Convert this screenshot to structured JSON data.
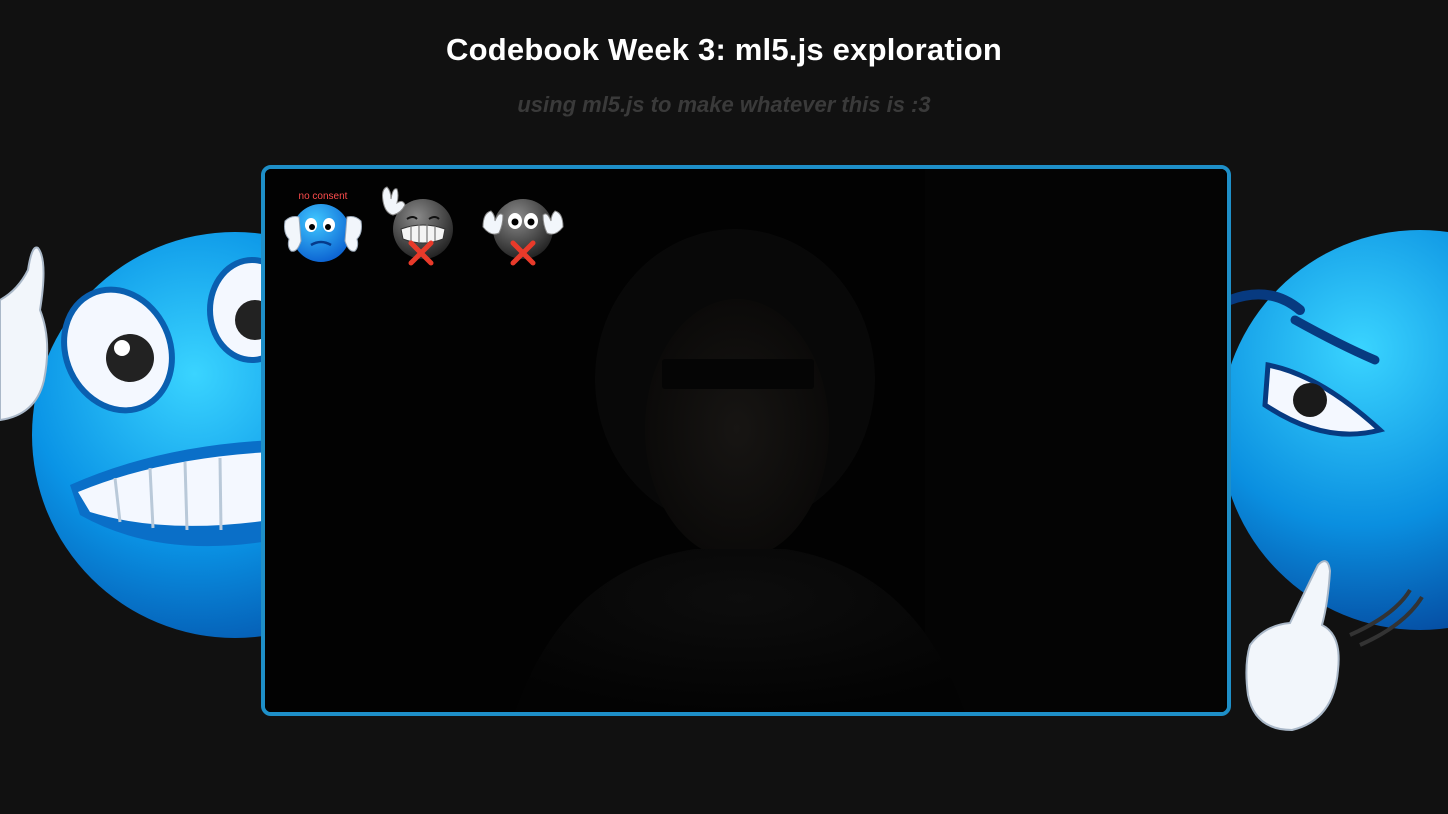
{
  "header": {
    "title": "Codebook Week 3: ml5.js exploration",
    "subtitle": "using ml5.js to make whatever this is :3"
  },
  "camera": {
    "face_censored": true
  },
  "gestures": [
    {
      "icon": "thumbs-down-emoji-icon",
      "label": "no consent",
      "active": true
    },
    {
      "icon": "waving-emoji-icon",
      "label": "",
      "active": false
    },
    {
      "icon": "hands-up-emoji-icon",
      "label": "",
      "active": false
    }
  ],
  "decorations": {
    "left": "grinning-thumbs-up-emoji-icon",
    "right": "thinking-pointing-emoji-icon"
  },
  "colors": {
    "background": "#111111",
    "frame_border": "#1e8fc8",
    "subtitle": "#3a3a3a",
    "label": "#ff4d4d",
    "cross": "#e83a2a"
  }
}
